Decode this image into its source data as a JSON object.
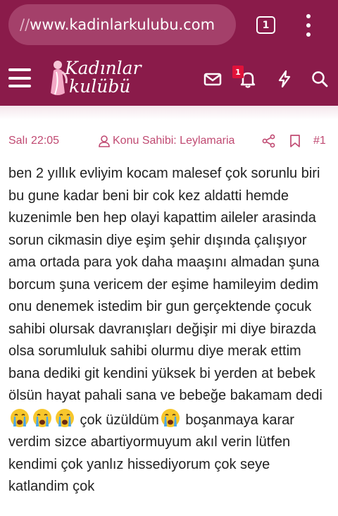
{
  "browser": {
    "url_scheme": "//",
    "url_host": "www.kadinlarkulubu.com",
    "tab_count": "1",
    "menu_icon": "more-vert-icon"
  },
  "header": {
    "logo_line1": "Kadınlar",
    "logo_line2": "kulübü",
    "notification_count": "1",
    "icons": [
      "menu-icon",
      "mail-icon",
      "bell-icon",
      "bolt-icon",
      "search-icon"
    ],
    "colors": {
      "brand": "#8a1b4a",
      "badge": "#e0123a"
    }
  },
  "post": {
    "time": "Salı 22:05",
    "author_label": "Konu Sahibi: Leylamaria",
    "number": "#1",
    "accent": "#c04a72",
    "body_part1": "ben 2 yıllık evliyim kocam malesef çok sorunlu biri bu gune kadar beni bir cok kez aldatti hemde kuzenimle ben hep olayi kapattim aileler arasinda sorun cikmasin diye eşim şehir dışında çalışıyor ama ortada para yok daha maaşını almadan şuna borcum şuna vericem der eşime hamileyim dedim onu denemek istedim bir gun gerçektende çocuk sahibi olursak davranışları değişir mi diye birazda olsa sorumluluk sahibi olurmu diye merak ettim bana dediki git kendini yüksek bi yerden at bebek ölsün hayat pahali sana ve bebeğe bakamam dedi",
    "body_part2": " çok üzüldüm",
    "body_part3": " boşanmaya karar verdim sizce abartiyormuyum akıl verin lütfen kendimi çok yanlız hissediyorum çok seye katlandim çok"
  }
}
